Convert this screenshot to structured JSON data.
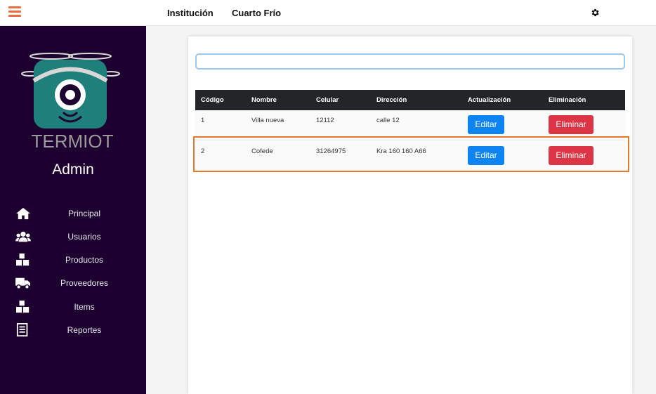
{
  "header": {
    "menu_icon": "hamburger-icon",
    "links": [
      "Institución",
      "Cuarto Frío"
    ],
    "settings_icon": "gear-icon"
  },
  "sidebar": {
    "logo_text": "TERMIOT",
    "role": "Admin",
    "items": [
      {
        "label": "Principal",
        "icon": "home-icon"
      },
      {
        "label": "Usuarios",
        "icon": "users-icon"
      },
      {
        "label": "Productos",
        "icon": "boxes-icon"
      },
      {
        "label": "Proveedores",
        "icon": "truck-icon"
      },
      {
        "label": "Items",
        "icon": "boxes-icon"
      },
      {
        "label": "Reportes",
        "icon": "report-icon"
      }
    ]
  },
  "search": {
    "value": "",
    "placeholder": ""
  },
  "table": {
    "headers": [
      "Código",
      "Nombre",
      "Celular",
      "Dirección",
      "Actualización",
      "Eliminación"
    ],
    "rows": [
      {
        "codigo": "1",
        "nombre": "Villa nueva",
        "celular": "12112",
        "direccion": "calle 12",
        "edit": "Editar",
        "delete": "Eliminar"
      },
      {
        "codigo": "2",
        "nombre": "Cofede",
        "celular": "31264975",
        "direccion": "Kra 160 160 A66",
        "edit": "Editar",
        "delete": "Eliminar"
      }
    ]
  },
  "colors": {
    "sidebar_bg": "#1d0030",
    "accent": "#e8703c",
    "edit_button": "#0d84f2",
    "delete_button": "#dc3545",
    "highlight": "#e07b2e"
  }
}
